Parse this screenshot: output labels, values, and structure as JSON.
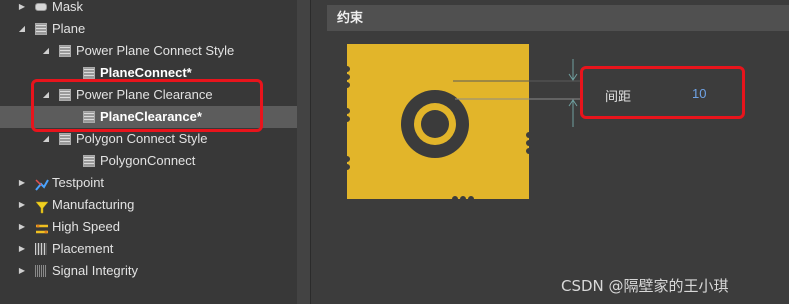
{
  "tree": {
    "items": [
      {
        "label": "Mask",
        "icon": "mask-icon"
      },
      {
        "label": "Plane",
        "icon": "rule-grid-icon"
      },
      {
        "label": "Power Plane Connect Style",
        "icon": "rule-grid-icon"
      },
      {
        "label": "PlaneConnect*",
        "icon": "rule-grid-icon"
      },
      {
        "label": "Power Plane Clearance",
        "icon": "rule-grid-icon"
      },
      {
        "label": "PlaneClearance*",
        "icon": "rule-grid-icon"
      },
      {
        "label": "Polygon Connect Style",
        "icon": "rule-grid-icon"
      },
      {
        "label": "PolygonConnect",
        "icon": "rule-grid-icon"
      },
      {
        "label": "Testpoint",
        "icon": "testpoint-icon"
      },
      {
        "label": "Manufacturing",
        "icon": "manufacturing-icon"
      },
      {
        "label": "High Speed",
        "icon": "high-speed-icon"
      },
      {
        "label": "Placement",
        "icon": "placement-icon"
      },
      {
        "label": "Signal Integrity",
        "icon": "signal-integrity-icon"
      }
    ]
  },
  "constraints": {
    "header": "约束",
    "field_label": "间距",
    "field_value": "10"
  },
  "watermark": "CSDN @隔壁家的王小琪",
  "colors": {
    "highlight": "#e8141c",
    "plane_fill": "#e2b52a",
    "plane_dark": "#3b3b3b",
    "value_blue": "#6fa3e6"
  }
}
